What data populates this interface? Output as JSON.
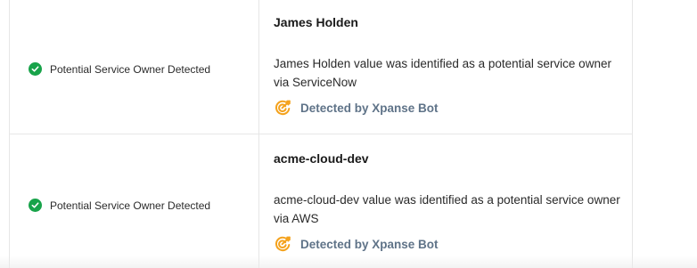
{
  "rows": [
    {
      "status": "Potential Service Owner Detected",
      "owner": "James Holden",
      "description": "James Holden value was identified as a potential service owner via ServiceNow",
      "detected_by": "Detected by Xpanse Bot"
    },
    {
      "status": "Potential Service Owner Detected",
      "owner": "acme-cloud-dev",
      "description": "acme-cloud-dev value was identified as a potential service owner via AWS",
      "detected_by": "Detected by Xpanse Bot"
    }
  ],
  "colors": {
    "status_green": "#18a34a",
    "bot_orange": "#f4a21d",
    "bot_label": "#5f7388",
    "border": "#e6e6e6"
  },
  "icons": {
    "status": "check-circle-icon",
    "bot": "xpanse-bot-icon"
  }
}
